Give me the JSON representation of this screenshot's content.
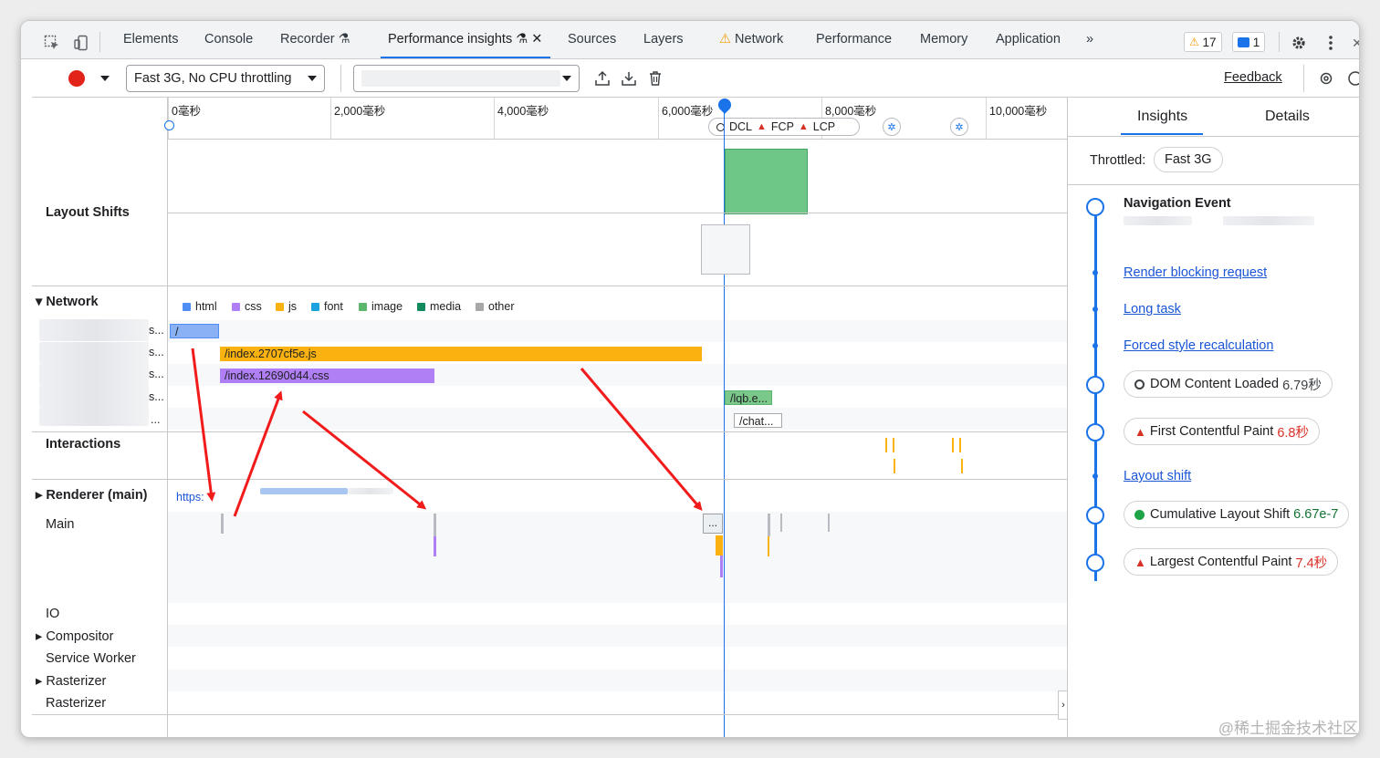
{
  "tabs": [
    "Elements",
    "Console",
    "Recorder",
    "Performance insights",
    "Sources",
    "Layers",
    "Network",
    "Performance",
    "Memory",
    "Application"
  ],
  "more_tabs": "»",
  "warnings_count": "17",
  "messages_count": "1",
  "toolbar": {
    "throttling": "Fast 3G, No CPU throttling",
    "recording_select": "",
    "feedback": "Feedback"
  },
  "ruler": [
    "0毫秒",
    "2,000毫秒",
    "4,000毫秒",
    "6,000毫秒",
    "8,000毫秒",
    "10,000毫秒"
  ],
  "markers": {
    "dcl": "DCL",
    "fcp": "FCP",
    "lcp": "LCP"
  },
  "tracks": {
    "layout_shifts": "Layout Shifts",
    "network": "Network",
    "interactions": "Interactions",
    "renderer": "Renderer (main)",
    "main": "Main",
    "io": "IO",
    "compositor": "Compositor",
    "service_worker": "Service Worker",
    "rasterizer_1": "Rasterizer",
    "rasterizer_2": "Rasterizer"
  },
  "legend": [
    {
      "label": "html",
      "color": "#4f8ef2"
    },
    {
      "label": "css",
      "color": "#b07ef5"
    },
    {
      "label": "js",
      "color": "#f9b20f"
    },
    {
      "label": "font",
      "color": "#1aa3e0"
    },
    {
      "label": "image",
      "color": "#5bb56a"
    },
    {
      "label": "media",
      "color": "#138a5e"
    },
    {
      "label": "other",
      "color": "#a8a8a8"
    }
  ],
  "network_rows": {
    "root": "/",
    "js": "/index.2707cf5e.js",
    "css": "/index.12690d44.css",
    "img": "/lqb.e...",
    "chat": "/chat...",
    "ellipsis": "...",
    "ellipsis_s": "s..."
  },
  "renderer_url": "https:",
  "main_more": "...",
  "side": {
    "tab_insights": "Insights",
    "tab_details": "Details",
    "throttled_label": "Throttled:",
    "throttled_value": "Fast 3G",
    "navigation_event": "Navigation Event",
    "render_blocking": "Render blocking request",
    "long_task": "Long task",
    "forced_style": "Forced style recalculation",
    "dcl_label": "DOM Content Loaded",
    "dcl_value": "6.79秒",
    "fcp_label": "First Contentful Paint",
    "fcp_value": "6.8秒",
    "layout_shift": "Layout shift",
    "cls_label": "Cumulative Layout Shift",
    "cls_value": "6.67e-7",
    "lcp_label": "Largest Contentful Paint",
    "lcp_value": "7.4秒"
  },
  "watermark": "@稀土掘金技术社区"
}
